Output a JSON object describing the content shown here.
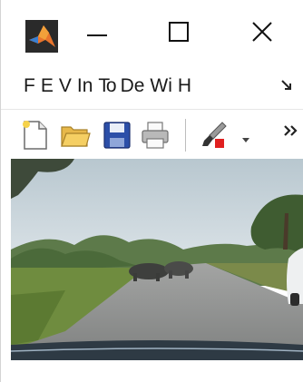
{
  "window": {
    "app_icon": "matlab-logo-icon",
    "controls": {
      "minimize_icon": "minimize-icon",
      "maximize_icon": "maximize-icon",
      "close_icon": "close-icon"
    }
  },
  "menubar": {
    "items": [
      {
        "label": "F"
      },
      {
        "label": "E"
      },
      {
        "label": "V"
      },
      {
        "label": "In"
      },
      {
        "label": "To"
      },
      {
        "label": "De"
      },
      {
        "label": "Wi"
      },
      {
        "label": "H"
      }
    ],
    "overflow_icon": "chevron-overflow-icon"
  },
  "toolbar": {
    "items": [
      {
        "icon": "new-file-icon"
      },
      {
        "icon": "open-folder-icon"
      },
      {
        "icon": "save-disk-icon"
      },
      {
        "icon": "print-icon"
      },
      {
        "icon": "brush-icon"
      }
    ],
    "dropdown_icon": "chevron-down-icon",
    "more_icon": "double-chevron-right-icon"
  },
  "colors": {
    "accent_red": "#e02020",
    "menu_text": "#1a1a1a",
    "sky": "#c9d6dd",
    "road": "#8d8f8f"
  }
}
